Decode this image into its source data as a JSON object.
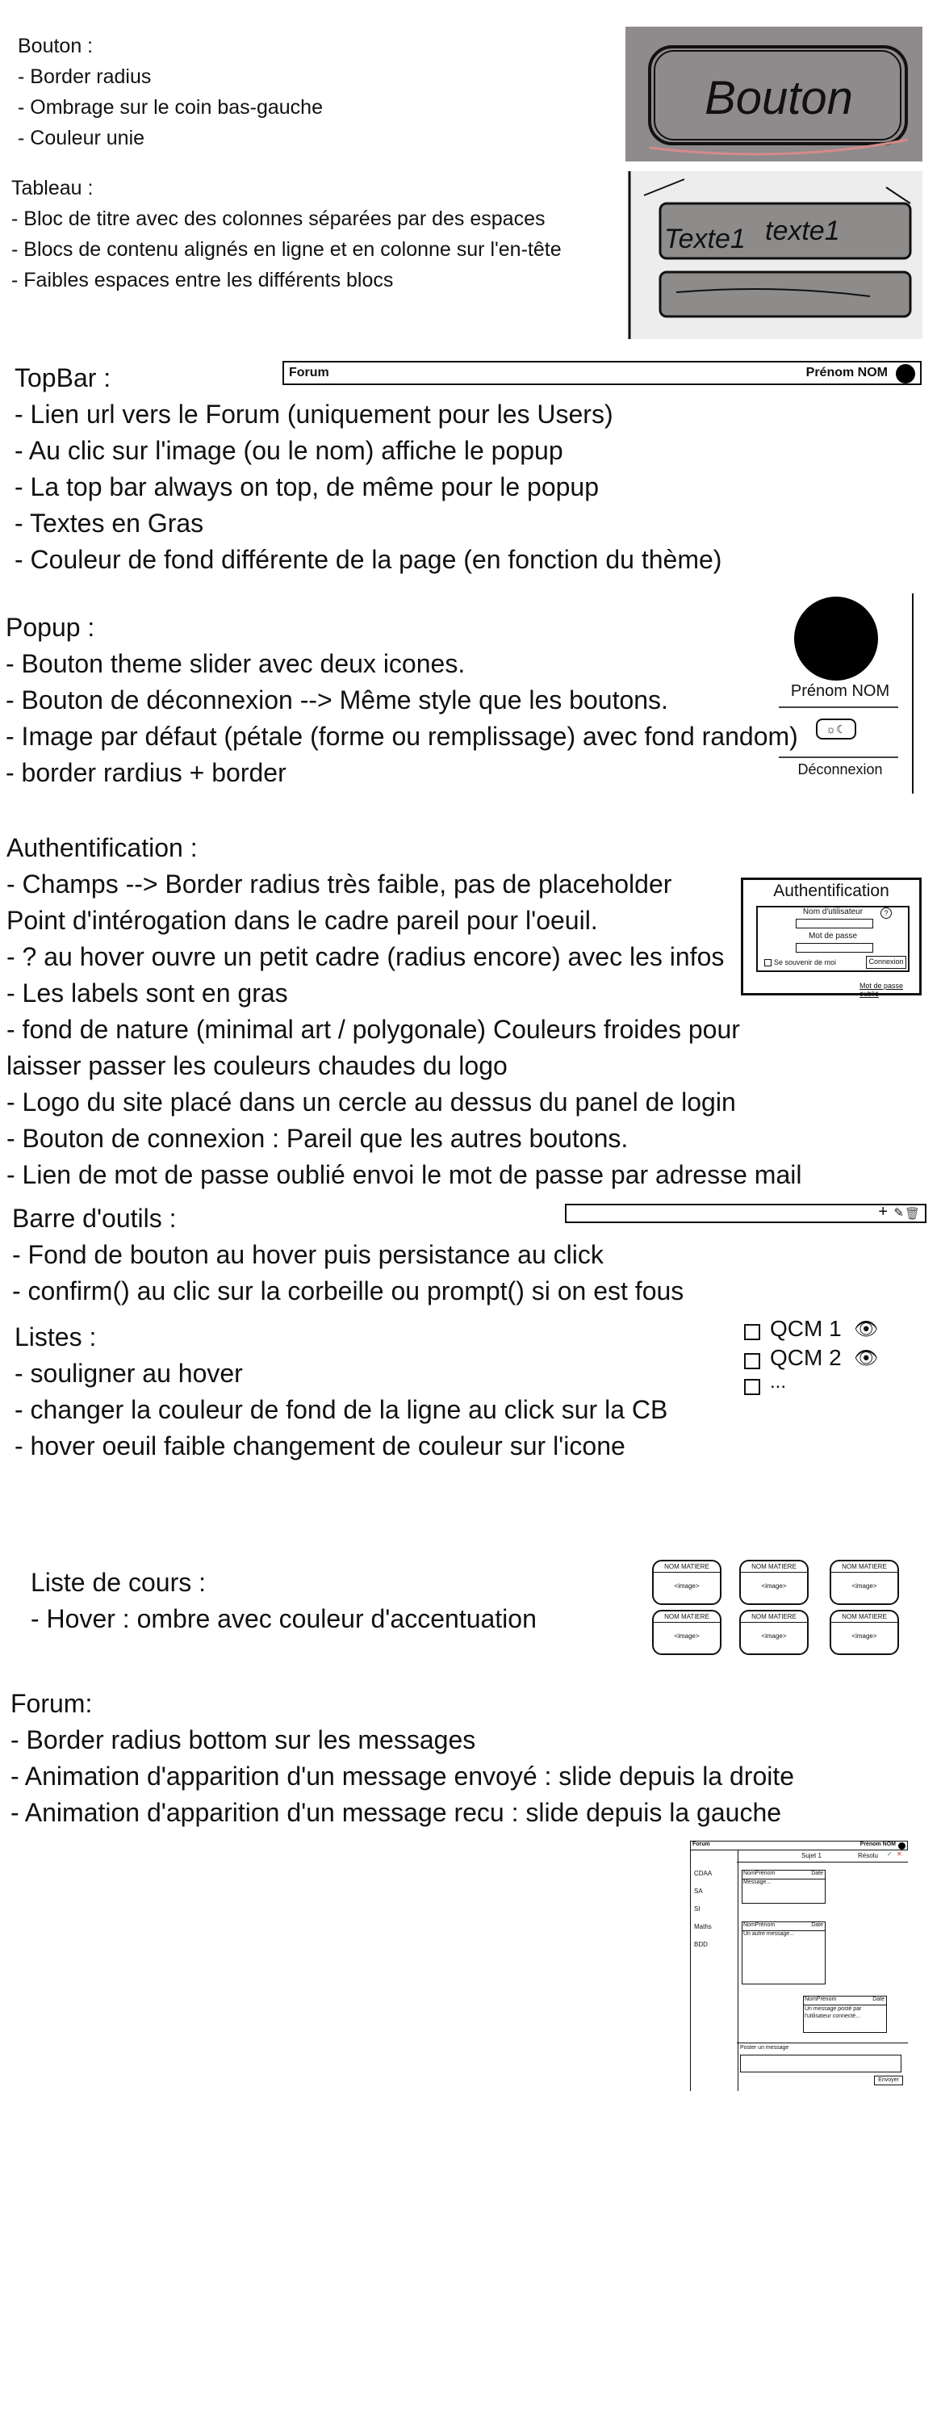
{
  "bouton": {
    "title": "Bouton :",
    "items": [
      "- Border radius",
      "- Ombrage sur le coin bas-gauche",
      "- Couleur unie"
    ],
    "sketch_label": "Bouton"
  },
  "tableau": {
    "title": "Tableau :",
    "items": [
      "- Bloc de titre avec des colonnes séparées par des espaces",
      "- Blocs de contenu alignés en ligne et en colonne sur l'en-tête",
      "- Faibles espaces entre les différents blocs"
    ],
    "sketch_labels": [
      "Texte1",
      "texte1"
    ]
  },
  "topbar": {
    "title": "TopBar :",
    "items": [
      "- Lien url vers le Forum (uniquement pour les Users)",
      "- Au clic sur l'image (ou le nom) affiche le popup",
      "- La top bar always on top, de même pour le popup",
      "- Textes en Gras",
      "- Couleur de fond différente de la page (en fonction du thème)"
    ],
    "mock_forum": "Forum",
    "mock_user": "Prénom NOM"
  },
  "popup": {
    "title": "Popup :",
    "items": [
      "- Bouton theme slider avec deux icones.",
      "- Bouton de déconnexion --> Même style que les boutons.",
      "- Image par défaut (pétale (forme ou remplissage) avec fond random)",
      "- border rardius + border"
    ],
    "mock_name": "Prénom NOM",
    "mock_logout": "Déconnexion"
  },
  "auth": {
    "title": "Authentification :",
    "items": [
      "-  Champs --> Border radius très faible, pas de placeholder",
      "Point d'intérogation dans le cadre pareil pour l'oeuil.",
      "- ? au hover ouvre un petit cadre (radius encore) avec les infos",
      "- Les labels sont en gras",
      "- fond de nature (minimal art / polygonale) Couleurs froides pour",
      "laisser passer les couleurs chaudes du logo",
      "- Logo du site placé dans un cercle au dessus du panel de login",
      "- Bouton de connexion : Pareil que les autres boutons.",
      "- Lien de mot de passe oublié envoi le mot de passe par adresse mail"
    ],
    "mock_title": "Authentification",
    "mock_user_label": "Nom d'utilisateur",
    "mock_pass_label": "Mot de passe",
    "mock_remember": "Se souvenir de moi",
    "mock_login": "Connexion",
    "mock_forgot": "Mot de passe oublié"
  },
  "toolbar": {
    "title": "Barre d'outils :",
    "items": [
      "- Fond de bouton au hover puis persistance au click",
      "- confirm() au clic sur la corbeille ou prompt() si on est fous"
    ]
  },
  "listes": {
    "title": "Listes :",
    "items": [
      "- souligner au hover",
      "- changer la couleur de fond de la ligne au click sur la CB",
      "- hover oeuil faible changement de couleur sur l'icone"
    ],
    "mock_items": [
      "QCM 1",
      "QCM 2",
      "..."
    ]
  },
  "cours": {
    "title": "Liste de cours :",
    "items": [
      "- Hover : ombre avec couleur d'accentuation"
    ],
    "card_title": "NOM MATIERE",
    "card_image": "<image>"
  },
  "forum": {
    "title": "Forum:",
    "items": [
      "- Border radius bottom sur les messages",
      "- Animation d'apparition d'un message envoyé : slide depuis la droite",
      "- Animation d'apparition d'un message recu : slide depuis la gauche"
    ],
    "mock_top_left": "Forum",
    "mock_top_right": "Prénom NOM",
    "mock_subject": "Sujet 1",
    "mock_resolved": "Résolu",
    "mock_sidebar": [
      "CDAA",
      "SA",
      "SI",
      "Maths",
      "BDD"
    ],
    "mock_msg_author": "NomPrénom",
    "mock_msg_date": "Date",
    "mock_msgs": [
      "Message...",
      "Un autre message...",
      "Un message posté par l'utilisateur connecté..."
    ],
    "mock_post_label": "Poster un message",
    "mock_send": "Envoyer"
  }
}
